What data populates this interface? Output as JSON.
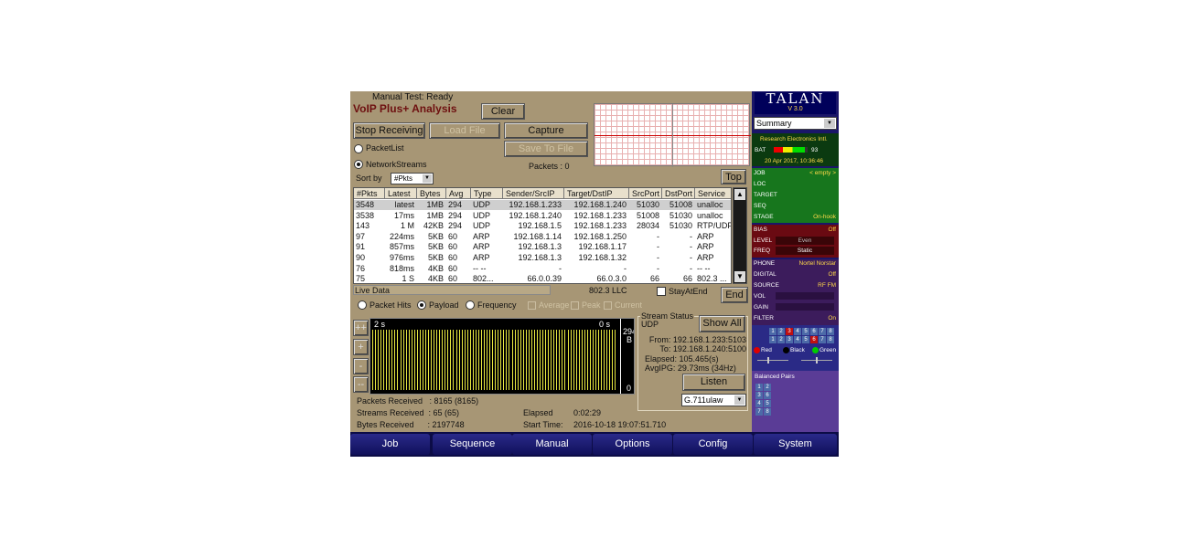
{
  "header": {
    "status": "Manual Test: Ready",
    "title": "VoIP Plus+ Analysis",
    "clear": "Clear",
    "stop_receiving": "Stop Receiving",
    "load_file": "Load File",
    "capture": "Capture",
    "save_to_file": "Save To File",
    "packets": "Packets : 0"
  },
  "mode": {
    "packet_list": "PacketList",
    "network_streams": "NetworkStreams",
    "sort_by": "Sort by",
    "sort_value": "#Pkts",
    "top": "Top"
  },
  "table": {
    "headers": [
      "#Pkts",
      "Latest",
      "Bytes",
      "Avg",
      "Type",
      "Sender/SrcIP",
      "Target/DstIP",
      "SrcPort",
      "DstPort",
      "Service"
    ],
    "rows": [
      [
        "3548",
        "latest",
        "1MB",
        "294",
        "UDP",
        "192.168.1.233",
        "192.168.1.240",
        "51030",
        "51008",
        "unalloc"
      ],
      [
        "3538",
        "17ms",
        "1MB",
        "294",
        "UDP",
        "192.168.1.240",
        "192.168.1.233",
        "51008",
        "51030",
        "unalloc"
      ],
      [
        "143",
        "1 M",
        "42KB",
        "294",
        "UDP",
        "192.168.1.5",
        "192.168.1.233",
        "28034",
        "51030",
        "RTP/UDP"
      ],
      [
        "97",
        "224ms",
        "5KB",
        "60",
        "ARP",
        "192.168.1.14",
        "192.168.1.250",
        "-",
        "-",
        "ARP"
      ],
      [
        "91",
        "857ms",
        "5KB",
        "60",
        "ARP",
        "192.168.1.3",
        "192.168.1.17",
        "-",
        "-",
        "ARP"
      ],
      [
        "90",
        "976ms",
        "5KB",
        "60",
        "ARP",
        "192.168.1.3",
        "192.168.1.32",
        "-",
        "-",
        "ARP"
      ],
      [
        "76",
        "818ms",
        "4KB",
        "60",
        "-- --",
        "-",
        "-",
        "-",
        "-",
        "-- --"
      ],
      [
        "75",
        "1 S",
        "4KB",
        "60",
        "802...",
        "66.0.0.39",
        "66.0.3.0",
        "66",
        "66",
        "802.3 ..."
      ]
    ]
  },
  "live": {
    "label": "Live Data",
    "llc": "802.3 LLC",
    "stay_at_end": "StayAtEnd",
    "end": "End",
    "packet_hits": "Packet Hits",
    "payload": "Payload",
    "frequency": "Frequency",
    "average": "Average",
    "peak": "Peak",
    "current": "Current"
  },
  "plot": {
    "left_label": "2 s",
    "right_label": "0 s",
    "value": "294",
    "unit": "B",
    "zero": "0",
    "zoom_in_x": "++",
    "zoom_plus": "+",
    "zoom_minus": "-",
    "zoom_out_x": "--"
  },
  "stream": {
    "legend": "Stream Status",
    "show_all": "Show All",
    "proto": "UDP",
    "from": "From: 192.168.1.233:5103",
    "to": "To: 192.168.1.240:5100",
    "elapsed": "Elapsed: 105.465(s)",
    "avg_ipg": "AvgIPG: 29.73ms (34Hz)",
    "listen": "Listen",
    "codec": "G.711ulaw"
  },
  "stats": {
    "packets_received": "Packets Received   : 8165 (8165)",
    "streams_received": "Streams Received  : 65 (65)",
    "bytes_received": "Bytes Received      : 2197748",
    "elapsed_label": "Elapsed",
    "elapsed_value": "0:02:29",
    "start_label": "Start Time:",
    "start_value": "2016-10-18 19:07:51.710"
  },
  "sidebar": {
    "logo": "TALAN",
    "version": "V 3.0",
    "view": "Summary",
    "company": "Research Electronics Intl.",
    "bat_label": "BAT",
    "bat_value": "93",
    "battery_level": 0.93,
    "datetime": "20 Apr 2017, 10:36:46",
    "job_label": "JOB",
    "job_value": "< empty >",
    "loc": "LOC",
    "target": "TARGET",
    "seq": "SEQ",
    "stage_label": "STAGE",
    "stage_value": "On-hook",
    "bias_label": "BIAS",
    "bias_value": "Off",
    "level_label": "LEVEL",
    "level_value": "Even",
    "freq_label": "FREQ",
    "freq_value": "Static",
    "phone_label": "PHONE",
    "phone_value": "Nortel Norstar",
    "digital_label": "DIGITAL",
    "digital_value": "Off",
    "source_label": "SOURCE",
    "source_value": "RF FM",
    "vol": "VOL",
    "gain": "GAIN",
    "filter_label": "FILTER",
    "filter_value": "On",
    "pins": [
      "1",
      "2",
      "3",
      "4",
      "5",
      "6",
      "7",
      "8"
    ],
    "red": "Red",
    "black": "Black",
    "green": "Green",
    "balanced_pairs": "Balanced Pairs",
    "pairs": [
      "1",
      "2",
      "3",
      "6",
      "4",
      "5",
      "7",
      "8"
    ]
  },
  "nav": [
    "Job",
    "Sequence",
    "Manual",
    "Options",
    "Config",
    "System"
  ],
  "colors": {
    "panel": "#a79675",
    "title": "#6e1010",
    "sidebar": "#1a1668",
    "trace": "#e8e840"
  }
}
